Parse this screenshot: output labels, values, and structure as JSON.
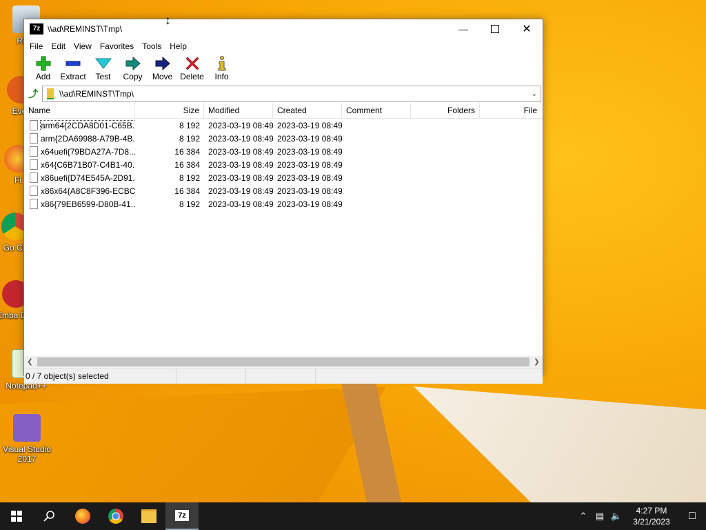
{
  "desktop": {
    "icons": [
      {
        "label": "Recy",
        "id": "recycle-bin"
      },
      {
        "label": "Ever",
        "id": "everything"
      },
      {
        "label": "Fi",
        "id": "firefox"
      },
      {
        "label": "Go Ch",
        "id": "chrome"
      },
      {
        "label": "Emba Dev",
        "id": "embarcadero"
      },
      {
        "label": "Notepad++",
        "id": "notepadpp"
      },
      {
        "label": "Visual Studio 2017",
        "id": "visual-studio"
      }
    ]
  },
  "window": {
    "app_icon_text": "7z",
    "title": "\\\\ad\\REMINST\\Tmp\\",
    "menu": [
      "File",
      "Edit",
      "View",
      "Favorites",
      "Tools",
      "Help"
    ],
    "toolbar": [
      {
        "label": "Add",
        "icon": "plus-icon"
      },
      {
        "label": "Extract",
        "icon": "minus-icon"
      },
      {
        "label": "Test",
        "icon": "test-check-icon"
      },
      {
        "label": "Copy",
        "icon": "copy-arrow-icon"
      },
      {
        "label": "Move",
        "icon": "move-arrow-icon"
      },
      {
        "label": "Delete",
        "icon": "delete-x-icon"
      },
      {
        "label": "Info",
        "icon": "info-icon"
      }
    ],
    "address": "\\\\ad\\REMINST\\Tmp\\",
    "columns": [
      "Name",
      "Size",
      "Modified",
      "Created",
      "Comment",
      "Folders",
      "File"
    ],
    "rows": [
      {
        "name": "arm64{2CDA8D01-C65B...",
        "size": "8 192",
        "modified": "2023-03-19 08:49",
        "created": "2023-03-19 08:49"
      },
      {
        "name": "arm{2DA69988-A79B-4B...",
        "size": "8 192",
        "modified": "2023-03-19 08:49",
        "created": "2023-03-19 08:49"
      },
      {
        "name": "x64uefi{79BDA27A-7D8...",
        "size": "16 384",
        "modified": "2023-03-19 08:49",
        "created": "2023-03-19 08:49"
      },
      {
        "name": "x64{C6B71B07-C4B1-40...",
        "size": "16 384",
        "modified": "2023-03-19 08:49",
        "created": "2023-03-19 08:49"
      },
      {
        "name": "x86uefi{D74E545A-2D91...",
        "size": "8 192",
        "modified": "2023-03-19 08:49",
        "created": "2023-03-19 08:49"
      },
      {
        "name": "x86x64{A8C8F396-ECBC...",
        "size": "16 384",
        "modified": "2023-03-19 08:49",
        "created": "2023-03-19 08:49"
      },
      {
        "name": "x86{79EB6599-D80B-41...",
        "size": "8 192",
        "modified": "2023-03-19 08:49",
        "created": "2023-03-19 08:49"
      }
    ],
    "status": "0 / 7 object(s) selected"
  },
  "taskbar": {
    "time": "4:27 PM",
    "date": "3/21/2023",
    "active_app_text": "7z"
  },
  "colors": {
    "accent_green": "#2b8a1f",
    "delete_red": "#d9202a",
    "taskbar_bg": "#1a1a1a"
  }
}
